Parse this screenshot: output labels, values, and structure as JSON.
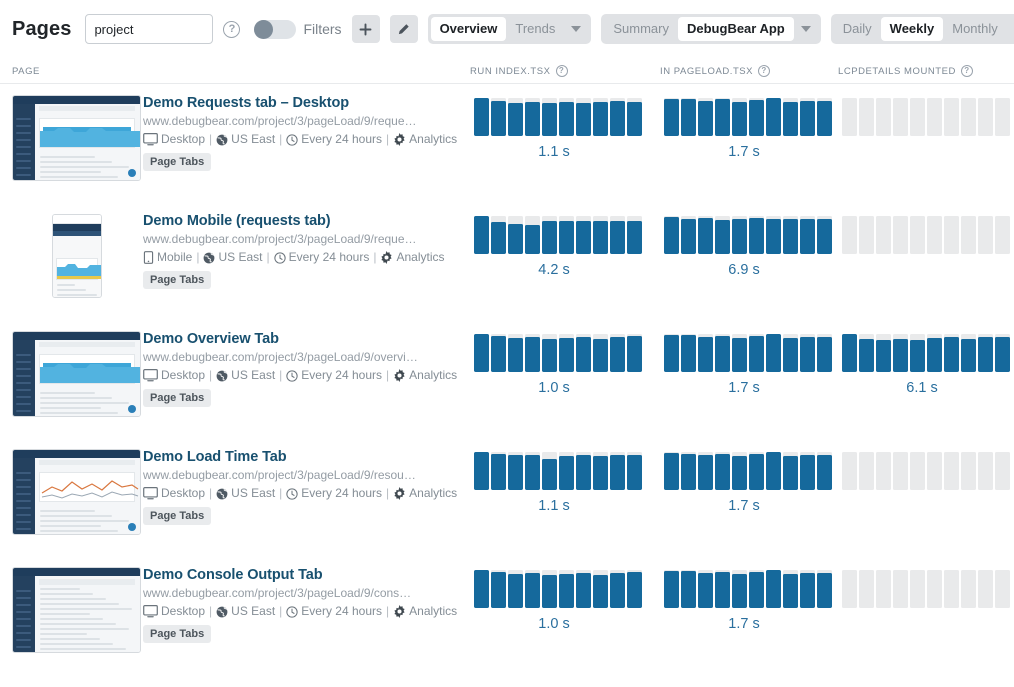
{
  "toolbar": {
    "title": "Pages",
    "search_value": "project",
    "search_placeholder": "",
    "help_glyph": "?",
    "filters_label": "Filters",
    "add_label": "+",
    "edit_label": "✎",
    "view_seg": {
      "overview": "Overview",
      "trends": "Trends"
    },
    "summary_seg": {
      "summary": "Summary",
      "app": "DebugBear App"
    },
    "period_seg": {
      "daily": "Daily",
      "weekly": "Weekly",
      "monthly": "Monthly"
    }
  },
  "columns": {
    "page": "PAGE",
    "metric1": "RUN INDEX.TSX",
    "metric2": "IN PAGELOAD.TSX",
    "metric3": "LCPDETAILS MOUNTED",
    "help_glyph": "?"
  },
  "colors": {
    "bar_fill": "#15699c",
    "bar_track": "#e9eaeb",
    "value_text": "#2a6f9e",
    "title_text": "#18506f"
  },
  "rows": [
    {
      "title": "Demo Requests tab – Desktop",
      "url": "www.debugbear.com/project/3/pageLoad/9/reque…",
      "device": "Desktop",
      "region": "US East",
      "frequency": "Every 24 hours",
      "analytics": "Analytics",
      "badge": "Page Tabs",
      "thumb_type": "desktop",
      "metrics": [
        {
          "value": "1.1 s",
          "empty": false,
          "bars": [
            100,
            92,
            88,
            90,
            86,
            90,
            88,
            90,
            91,
            89
          ]
        },
        {
          "value": "1.7 s",
          "empty": false,
          "bars": [
            97,
            97,
            92,
            97,
            90,
            95,
            100,
            90,
            92,
            93
          ]
        },
        {
          "value": "",
          "empty": true,
          "bars": [
            0,
            0,
            0,
            0,
            0,
            0,
            0,
            0,
            0,
            0
          ]
        }
      ]
    },
    {
      "title": "Demo Mobile (requests tab)",
      "url": "www.debugbear.com/project/3/pageLoad/9/reque…",
      "device": "Mobile",
      "region": "US East",
      "frequency": "Every 24 hours",
      "analytics": "Analytics",
      "badge": "Page Tabs",
      "thumb_type": "mobile",
      "metrics": [
        {
          "value": "4.2 s",
          "empty": false,
          "bars": [
            100,
            84,
            78,
            76,
            88,
            88,
            88,
            88,
            88,
            88
          ]
        },
        {
          "value": "6.9 s",
          "empty": false,
          "bars": [
            97,
            92,
            95,
            90,
            92,
            95,
            92,
            92,
            93,
            92
          ]
        },
        {
          "value": "",
          "empty": true,
          "bars": [
            0,
            0,
            0,
            0,
            0,
            0,
            0,
            0,
            0,
            0
          ]
        }
      ]
    },
    {
      "title": "Demo Overview Tab",
      "url": "www.debugbear.com/project/3/pageLoad/9/overvi…",
      "device": "Desktop",
      "region": "US East",
      "frequency": "Every 24 hours",
      "analytics": "Analytics",
      "badge": "Page Tabs",
      "thumb_type": "desktop",
      "metrics": [
        {
          "value": "1.0 s",
          "empty": false,
          "bars": [
            100,
            94,
            90,
            92,
            88,
            90,
            92,
            88,
            92,
            95
          ]
        },
        {
          "value": "1.7 s",
          "empty": false,
          "bars": [
            97,
            97,
            92,
            95,
            90,
            95,
            100,
            90,
            92,
            93
          ]
        },
        {
          "value": "6.1 s",
          "empty": false,
          "bars": [
            100,
            86,
            84,
            86,
            84,
            90,
            92,
            86,
            92,
            92
          ]
        }
      ]
    },
    {
      "title": "Demo Load Time Tab",
      "url": "www.debugbear.com/project/3/pageLoad/9/resou…",
      "device": "Desktop",
      "region": "US East",
      "frequency": "Every 24 hours",
      "analytics": "Analytics",
      "badge": "Page Tabs",
      "thumb_type": "desktop-line",
      "metrics": [
        {
          "value": "1.1 s",
          "empty": false,
          "bars": [
            100,
            94,
            92,
            92,
            82,
            90,
            92,
            90,
            92,
            92
          ]
        },
        {
          "value": "1.7 s",
          "empty": false,
          "bars": [
            97,
            95,
            92,
            95,
            90,
            95,
            100,
            90,
            92,
            93
          ]
        },
        {
          "value": "",
          "empty": true,
          "bars": [
            0,
            0,
            0,
            0,
            0,
            0,
            0,
            0,
            0,
            0
          ]
        }
      ]
    },
    {
      "title": "Demo Console Output Tab",
      "url": "www.debugbear.com/project/3/pageLoad/9/cons…",
      "device": "Desktop",
      "region": "US East",
      "frequency": "Every 24 hours",
      "analytics": "Analytics",
      "badge": "Page Tabs",
      "thumb_type": "desktop-text",
      "metrics": [
        {
          "value": "1.0 s",
          "empty": false,
          "bars": [
            100,
            94,
            90,
            92,
            88,
            90,
            92,
            88,
            92,
            95
          ]
        },
        {
          "value": "1.7 s",
          "empty": false,
          "bars": [
            97,
            97,
            92,
            95,
            90,
            95,
            100,
            90,
            92,
            93
          ]
        },
        {
          "value": "",
          "empty": true,
          "bars": [
            0,
            0,
            0,
            0,
            0,
            0,
            0,
            0,
            0,
            0
          ]
        }
      ]
    }
  ]
}
